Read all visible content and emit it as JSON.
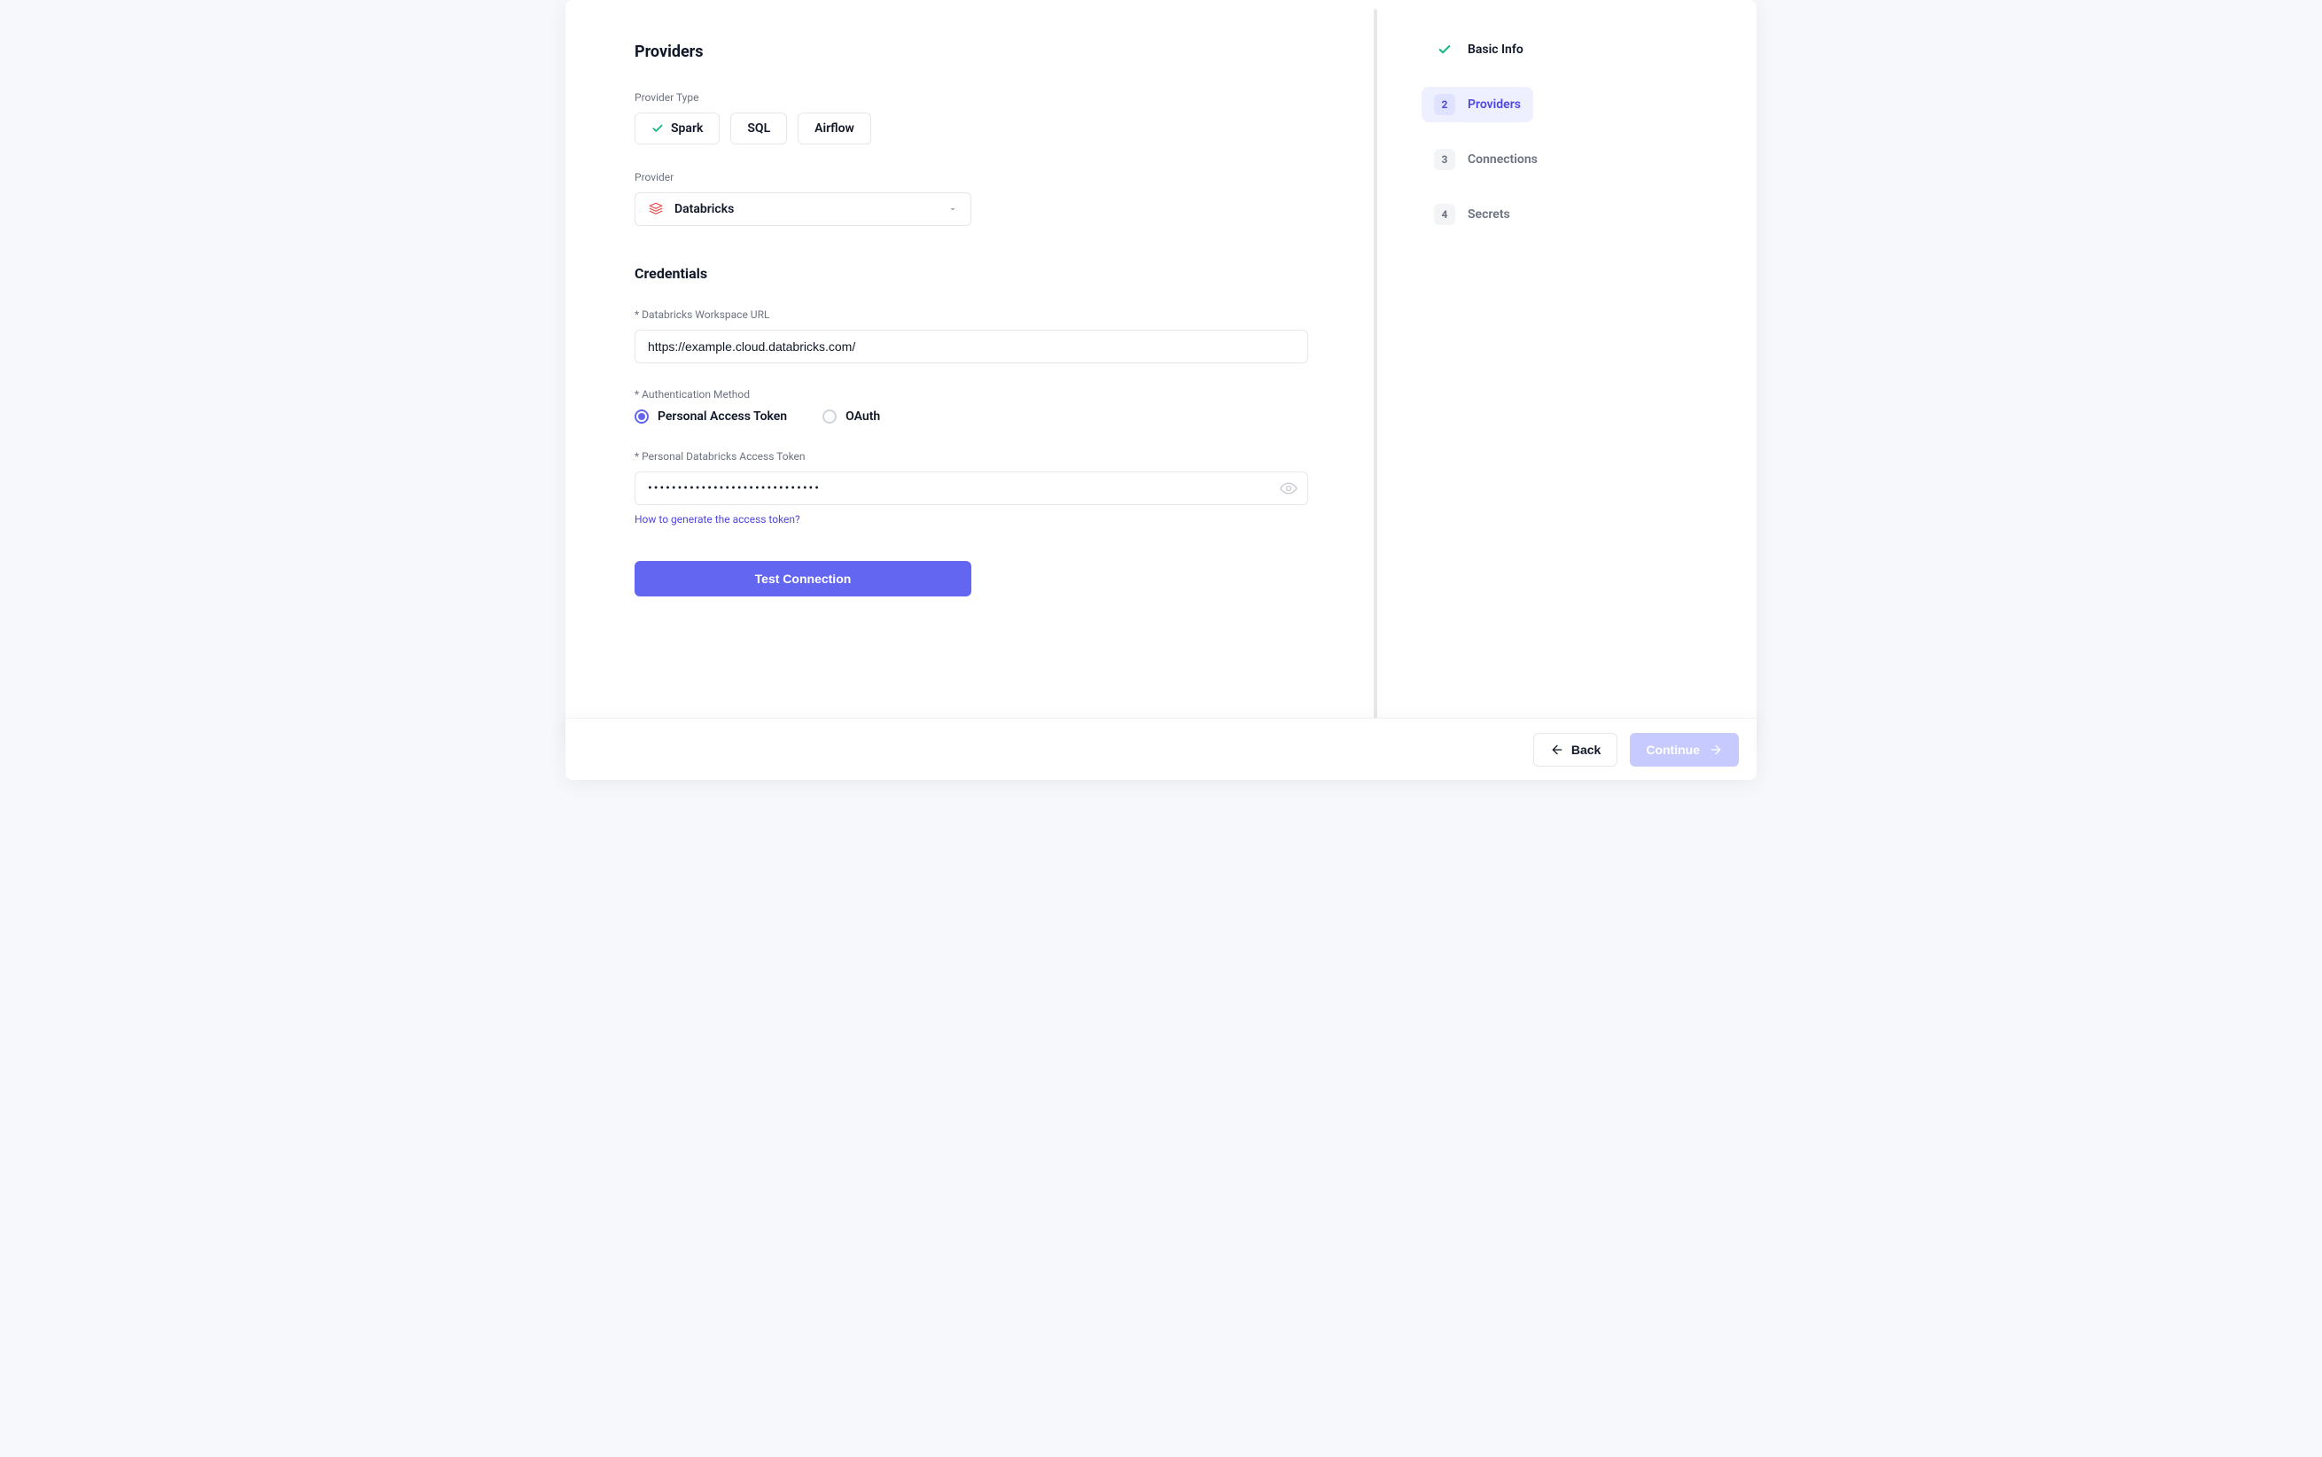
{
  "section": {
    "title": "Providers",
    "providerTypeLabel": "Provider Type",
    "providerLabel": "Provider",
    "credentialsTitle": "Credentials"
  },
  "providerTypes": [
    {
      "label": "Spark",
      "selected": true
    },
    {
      "label": "SQL",
      "selected": false
    },
    {
      "label": "Airflow",
      "selected": false
    }
  ],
  "providerSelect": {
    "value": "Databricks"
  },
  "credentials": {
    "workspaceUrl": {
      "label": "Databricks Workspace URL",
      "value": "https://example.cloud.databricks.com/"
    },
    "authMethod": {
      "label": "Authentication Method",
      "options": [
        {
          "label": "Personal Access Token",
          "selected": true
        },
        {
          "label": "OAuth",
          "selected": false
        }
      ]
    },
    "token": {
      "label": "Personal Databricks Access Token",
      "masked": "•••••••••••••••••••••••••••••"
    },
    "helpLink": "How to generate the access token?",
    "testButton": "Test Connection"
  },
  "stepper": [
    {
      "label": "Basic Info",
      "state": "done"
    },
    {
      "num": "2",
      "label": "Providers",
      "state": "active"
    },
    {
      "num": "3",
      "label": "Connections",
      "state": "pending"
    },
    {
      "num": "4",
      "label": "Secrets",
      "state": "pending"
    }
  ],
  "footer": {
    "back": "Back",
    "continue": "Continue"
  }
}
